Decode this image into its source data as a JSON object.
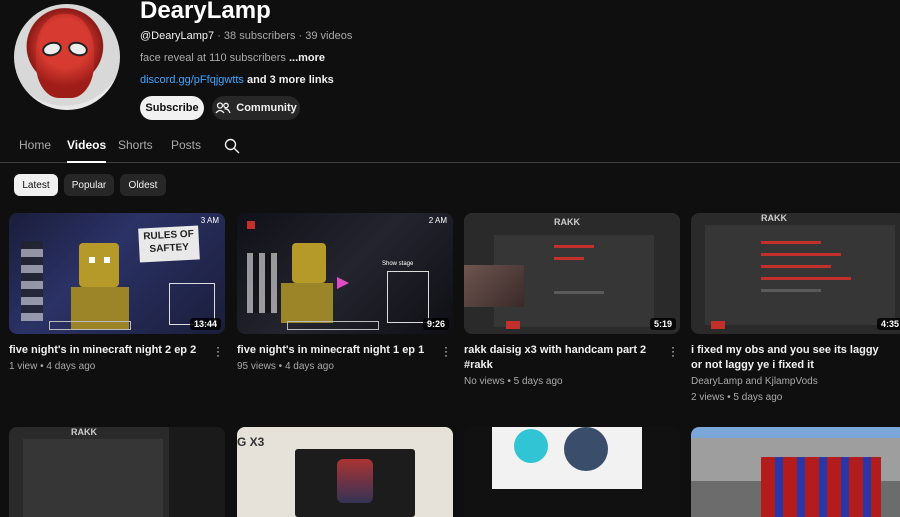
{
  "channel": {
    "name": "DearyLamp",
    "handle": "@DearyLamp7",
    "stats": " · 38 subscribers · 39 videos",
    "description": "face reveal at 110 subscribers ",
    "more": "...more",
    "link": "discord.gg/pFfqjgwtts",
    "more_links": " and 3 more links",
    "subscribe_label": "Subscribe",
    "community_label": "Community"
  },
  "tabs": [
    {
      "label": "Home",
      "active": false
    },
    {
      "label": "Videos",
      "active": true
    },
    {
      "label": "Shorts",
      "active": false
    },
    {
      "label": "Posts",
      "active": false
    }
  ],
  "chips": [
    {
      "label": "Latest",
      "active": true
    },
    {
      "label": "Popular",
      "active": false
    },
    {
      "label": "Oldest",
      "active": false
    }
  ],
  "videos": [
    {
      "title": "five night's in minecraft night 2 ep 2",
      "duration": "13:44",
      "author": "",
      "views": "1 view",
      "age": "4 days ago",
      "thumb_text": [
        "RULES OF",
        "SAFTEY",
        "3 AM"
      ]
    },
    {
      "title": "five night's in minecraft night 1 ep 1",
      "duration": "9:26",
      "author": "",
      "views": "95 views",
      "age": "4 days ago",
      "thumb_text": [
        "2 AM",
        "Show stage"
      ]
    },
    {
      "title": "rakk daisig x3 with handcam part 2 #rakk",
      "duration": "5:19",
      "author": "",
      "views": "No views",
      "age": "5 days ago",
      "thumb_text": [
        "RAKK"
      ]
    },
    {
      "title": "i fixed my obs and you see its laggy or not laggy ye i fixed it",
      "duration": "4:35",
      "author": "DearyLamp and KjlampVods",
      "views": "2 views",
      "age": "5 days ago",
      "thumb_text": [
        "RAKK"
      ]
    }
  ],
  "row2_thumb_text": [
    "RAKK",
    "G X3"
  ],
  "colors": {
    "bg": "#0f0f0f",
    "link": "#3ea6ff",
    "accent_red": "#c2302b"
  }
}
